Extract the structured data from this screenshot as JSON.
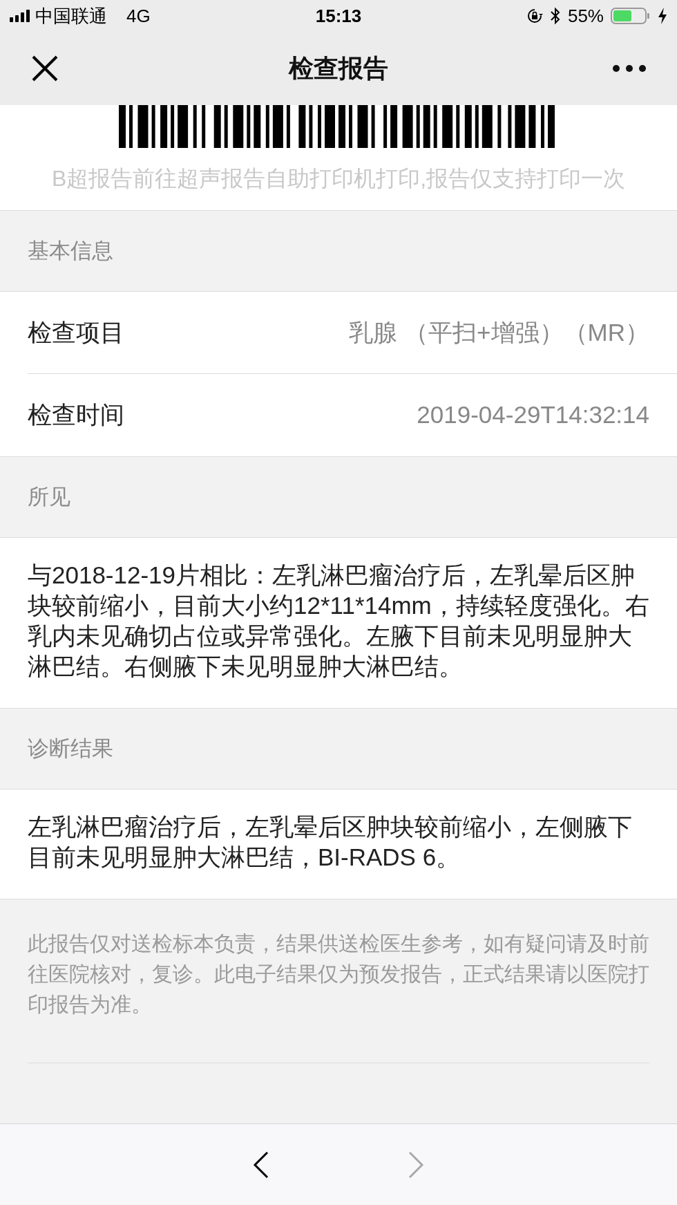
{
  "status_bar": {
    "carrier": "中国联通",
    "network": "4G",
    "time": "15:13",
    "battery": "55%"
  },
  "nav": {
    "title": "检查报告"
  },
  "barcode_note": "B超报告前往超声报告自助打印机打印,报告仅支持打印一次",
  "sections": [
    {
      "header": "基本信息",
      "kind": "fields",
      "rows": [
        {
          "label": "检查项目",
          "value": "乳腺 （平扫+增强）（MR）"
        },
        {
          "label": "检查时间",
          "value": "2019-04-29T14:32:14"
        }
      ]
    },
    {
      "header": "所见",
      "kind": "text",
      "text": "与2018-12-19片相比：左乳淋巴瘤治疗后，左乳晕后区肿块较前缩小，目前大小约12*11*14mm，持续轻度强化。右乳内未见确切占位或异常强化。左腋下目前未见明显肿大淋巴结。右侧腋下未见明显肿大淋巴结。"
    },
    {
      "header": "诊断结果",
      "kind": "text",
      "text": "左乳淋巴瘤治疗后，左乳晕后区肿块较前缩小，左侧腋下目前未见明显肿大淋巴结，BI-RADS 6。"
    }
  ],
  "disclaimer": "此报告仅对送检标本负责，结果供送检医生参考，如有疑问请及时前往医院核对，复诊。此电子结果仅为预发报告，正式结果请以医院打印报告为准。",
  "toolbar": [
    {
      "kind": "back",
      "disabled": false
    },
    {
      "kind": "forward",
      "disabled": true
    }
  ]
}
